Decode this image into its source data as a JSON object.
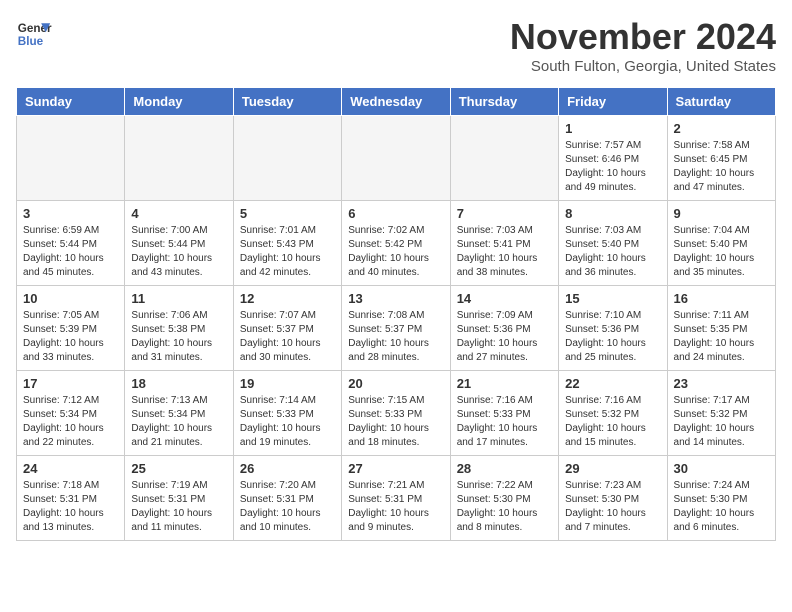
{
  "header": {
    "logo_line1": "General",
    "logo_line2": "Blue",
    "month": "November 2024",
    "location": "South Fulton, Georgia, United States"
  },
  "days_of_week": [
    "Sunday",
    "Monday",
    "Tuesday",
    "Wednesday",
    "Thursday",
    "Friday",
    "Saturday"
  ],
  "weeks": [
    [
      {
        "day": "",
        "detail": ""
      },
      {
        "day": "",
        "detail": ""
      },
      {
        "day": "",
        "detail": ""
      },
      {
        "day": "",
        "detail": ""
      },
      {
        "day": "",
        "detail": ""
      },
      {
        "day": "1",
        "detail": "Sunrise: 7:57 AM\nSunset: 6:46 PM\nDaylight: 10 hours\nand 49 minutes."
      },
      {
        "day": "2",
        "detail": "Sunrise: 7:58 AM\nSunset: 6:45 PM\nDaylight: 10 hours\nand 47 minutes."
      }
    ],
    [
      {
        "day": "3",
        "detail": "Sunrise: 6:59 AM\nSunset: 5:44 PM\nDaylight: 10 hours\nand 45 minutes."
      },
      {
        "day": "4",
        "detail": "Sunrise: 7:00 AM\nSunset: 5:44 PM\nDaylight: 10 hours\nand 43 minutes."
      },
      {
        "day": "5",
        "detail": "Sunrise: 7:01 AM\nSunset: 5:43 PM\nDaylight: 10 hours\nand 42 minutes."
      },
      {
        "day": "6",
        "detail": "Sunrise: 7:02 AM\nSunset: 5:42 PM\nDaylight: 10 hours\nand 40 minutes."
      },
      {
        "day": "7",
        "detail": "Sunrise: 7:03 AM\nSunset: 5:41 PM\nDaylight: 10 hours\nand 38 minutes."
      },
      {
        "day": "8",
        "detail": "Sunrise: 7:03 AM\nSunset: 5:40 PM\nDaylight: 10 hours\nand 36 minutes."
      },
      {
        "day": "9",
        "detail": "Sunrise: 7:04 AM\nSunset: 5:40 PM\nDaylight: 10 hours\nand 35 minutes."
      }
    ],
    [
      {
        "day": "10",
        "detail": "Sunrise: 7:05 AM\nSunset: 5:39 PM\nDaylight: 10 hours\nand 33 minutes."
      },
      {
        "day": "11",
        "detail": "Sunrise: 7:06 AM\nSunset: 5:38 PM\nDaylight: 10 hours\nand 31 minutes."
      },
      {
        "day": "12",
        "detail": "Sunrise: 7:07 AM\nSunset: 5:37 PM\nDaylight: 10 hours\nand 30 minutes."
      },
      {
        "day": "13",
        "detail": "Sunrise: 7:08 AM\nSunset: 5:37 PM\nDaylight: 10 hours\nand 28 minutes."
      },
      {
        "day": "14",
        "detail": "Sunrise: 7:09 AM\nSunset: 5:36 PM\nDaylight: 10 hours\nand 27 minutes."
      },
      {
        "day": "15",
        "detail": "Sunrise: 7:10 AM\nSunset: 5:36 PM\nDaylight: 10 hours\nand 25 minutes."
      },
      {
        "day": "16",
        "detail": "Sunrise: 7:11 AM\nSunset: 5:35 PM\nDaylight: 10 hours\nand 24 minutes."
      }
    ],
    [
      {
        "day": "17",
        "detail": "Sunrise: 7:12 AM\nSunset: 5:34 PM\nDaylight: 10 hours\nand 22 minutes."
      },
      {
        "day": "18",
        "detail": "Sunrise: 7:13 AM\nSunset: 5:34 PM\nDaylight: 10 hours\nand 21 minutes."
      },
      {
        "day": "19",
        "detail": "Sunrise: 7:14 AM\nSunset: 5:33 PM\nDaylight: 10 hours\nand 19 minutes."
      },
      {
        "day": "20",
        "detail": "Sunrise: 7:15 AM\nSunset: 5:33 PM\nDaylight: 10 hours\nand 18 minutes."
      },
      {
        "day": "21",
        "detail": "Sunrise: 7:16 AM\nSunset: 5:33 PM\nDaylight: 10 hours\nand 17 minutes."
      },
      {
        "day": "22",
        "detail": "Sunrise: 7:16 AM\nSunset: 5:32 PM\nDaylight: 10 hours\nand 15 minutes."
      },
      {
        "day": "23",
        "detail": "Sunrise: 7:17 AM\nSunset: 5:32 PM\nDaylight: 10 hours\nand 14 minutes."
      }
    ],
    [
      {
        "day": "24",
        "detail": "Sunrise: 7:18 AM\nSunset: 5:31 PM\nDaylight: 10 hours\nand 13 minutes."
      },
      {
        "day": "25",
        "detail": "Sunrise: 7:19 AM\nSunset: 5:31 PM\nDaylight: 10 hours\nand 11 minutes."
      },
      {
        "day": "26",
        "detail": "Sunrise: 7:20 AM\nSunset: 5:31 PM\nDaylight: 10 hours\nand 10 minutes."
      },
      {
        "day": "27",
        "detail": "Sunrise: 7:21 AM\nSunset: 5:31 PM\nDaylight: 10 hours\nand 9 minutes."
      },
      {
        "day": "28",
        "detail": "Sunrise: 7:22 AM\nSunset: 5:30 PM\nDaylight: 10 hours\nand 8 minutes."
      },
      {
        "day": "29",
        "detail": "Sunrise: 7:23 AM\nSunset: 5:30 PM\nDaylight: 10 hours\nand 7 minutes."
      },
      {
        "day": "30",
        "detail": "Sunrise: 7:24 AM\nSunset: 5:30 PM\nDaylight: 10 hours\nand 6 minutes."
      }
    ]
  ]
}
